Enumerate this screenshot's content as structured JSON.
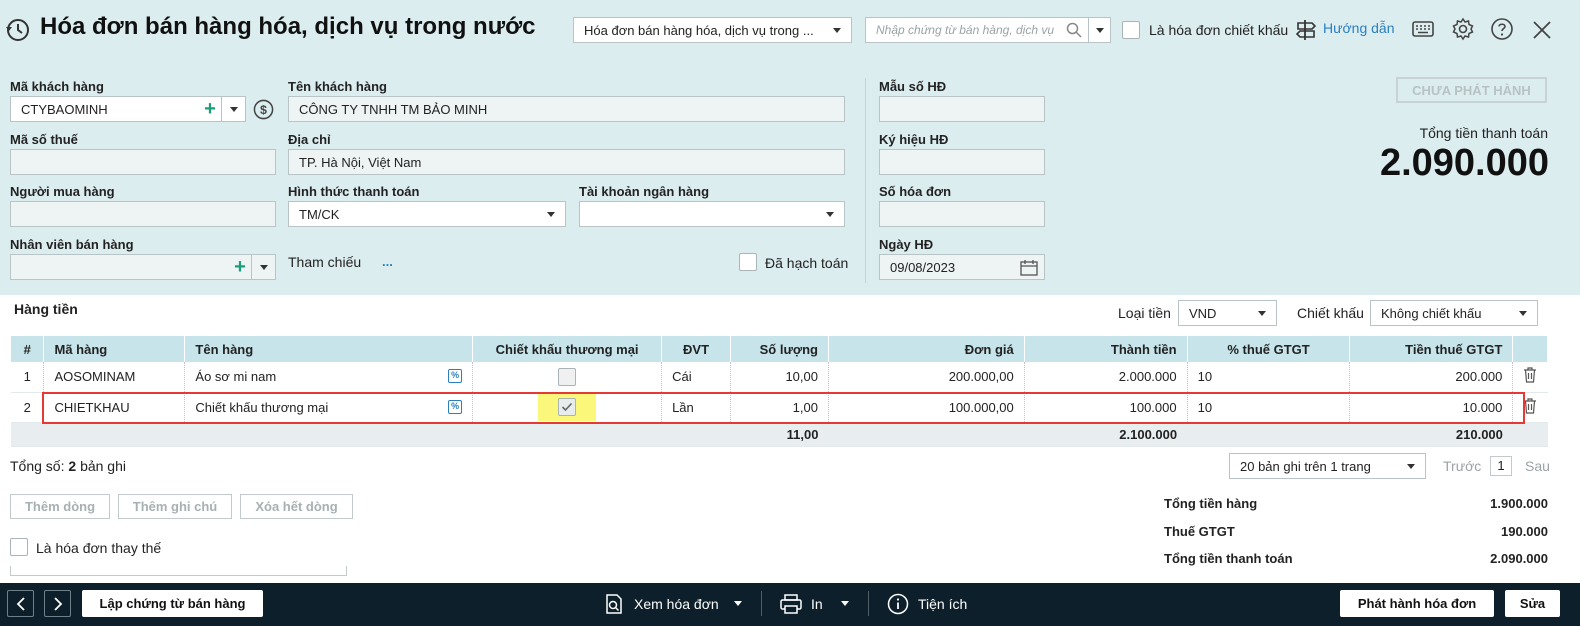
{
  "header": {
    "title": "Hóa đơn bán hàng hóa, dịch vụ trong nước",
    "type_select": "Hóa đơn bán hàng hóa, dịch vụ trong ...",
    "search_placeholder": "Nhập chứng từ bán hàng, dịch vụ",
    "discount_invoice_label": "Là hóa đơn chiết khấu",
    "help_label": "Hướng dẫn"
  },
  "form": {
    "customer_code_label": "Mã khách hàng",
    "customer_code": "CTYBAOMINH",
    "customer_name_label": "Tên khách hàng",
    "customer_name": "CÔNG TY TNHH TM BẢO MINH",
    "tax_code_label": "Mã số thuế",
    "tax_code": "",
    "address_label": "Địa chỉ",
    "address": "TP. Hà Nội, Việt Nam",
    "buyer_label": "Người mua hàng",
    "buyer": "",
    "payment_method_label": "Hình thức thanh toán",
    "payment_method": "TM/CK",
    "bank_account_label": "Tài khoản ngân hàng",
    "bank_account": "",
    "salesperson_label": "Nhân viên bán hàng",
    "salesperson": "",
    "reference_label": "Tham chiếu",
    "reference_more": "...",
    "posted_label": "Đã hạch toán",
    "template_label": "Mẫu số HĐ",
    "symbol_label": "Ký hiệu HĐ",
    "invoice_no_label": "Số hóa đơn",
    "date_label": "Ngày HĐ",
    "date": "09/08/2023"
  },
  "status": {
    "badge": "CHƯA PHÁT HÀNH",
    "total_label": "Tổng tiền thanh toán",
    "total_value": "2.090.000"
  },
  "grid": {
    "section_title": "Hàng tiền",
    "currency_label": "Loại tiền",
    "currency": "VND",
    "discount_label": "Chiết khấu",
    "discount": "Không chiết khấu",
    "columns": [
      "#",
      "Mã hàng",
      "Tên hàng",
      "Chiết khấu thương mại",
      "ĐVT",
      "Số lượng",
      "Đơn giá",
      "Thành tiền",
      "% thuế GTGT",
      "Tiền thuế GTGT"
    ],
    "rows": [
      {
        "no": "1",
        "code": "AOSOMINAM",
        "name": "Áo sơ mi nam",
        "discount": false,
        "unit": "Cái",
        "qty": "10,00",
        "price": "200.000,00",
        "amount": "2.000.000",
        "vat_pct": "10",
        "vat": "200.000"
      },
      {
        "no": "2",
        "code": "CHIETKHAU",
        "name": "Chiết khấu thương mại",
        "discount": true,
        "unit": "Lần",
        "qty": "1,00",
        "price": "100.000,00",
        "amount": "100.000",
        "vat_pct": "10",
        "vat": "10.000"
      }
    ],
    "totals": {
      "qty": "11,00",
      "amount": "2.100.000",
      "vat": "210.000"
    },
    "record_count_label": "Tổng số:",
    "record_count": "2",
    "record_count_suffix": "bản ghi",
    "page_size": "20 bản ghi trên 1 trang",
    "prev": "Trước",
    "page": "1",
    "next": "Sau"
  },
  "actions": {
    "add_row": "Thêm dòng",
    "add_note": "Thêm ghi chú",
    "delete_all": "Xóa hết dòng",
    "replacement_label": "Là hóa đơn thay thế"
  },
  "summary": {
    "goods_label": "Tổng tiền hàng",
    "goods_value": "1.900.000",
    "vat_label": "Thuế GTGT",
    "vat_value": "190.000",
    "total_label": "Tổng tiền thanh toán",
    "total_value": "2.090.000"
  },
  "footer": {
    "create_voucher": "Lập chứng từ bán hàng",
    "view_invoice": "Xem hóa đơn",
    "print": "In",
    "utilities": "Tiện ích",
    "issue": "Phát hành hóa đơn",
    "edit": "Sửa"
  },
  "colors": {
    "header_bg": "#dcedf0",
    "grid_header_bg": "#c6e4ea",
    "highlight_red": "#e53935",
    "footer_bg": "#0d1f2a",
    "link_blue": "#2a7fc1"
  }
}
